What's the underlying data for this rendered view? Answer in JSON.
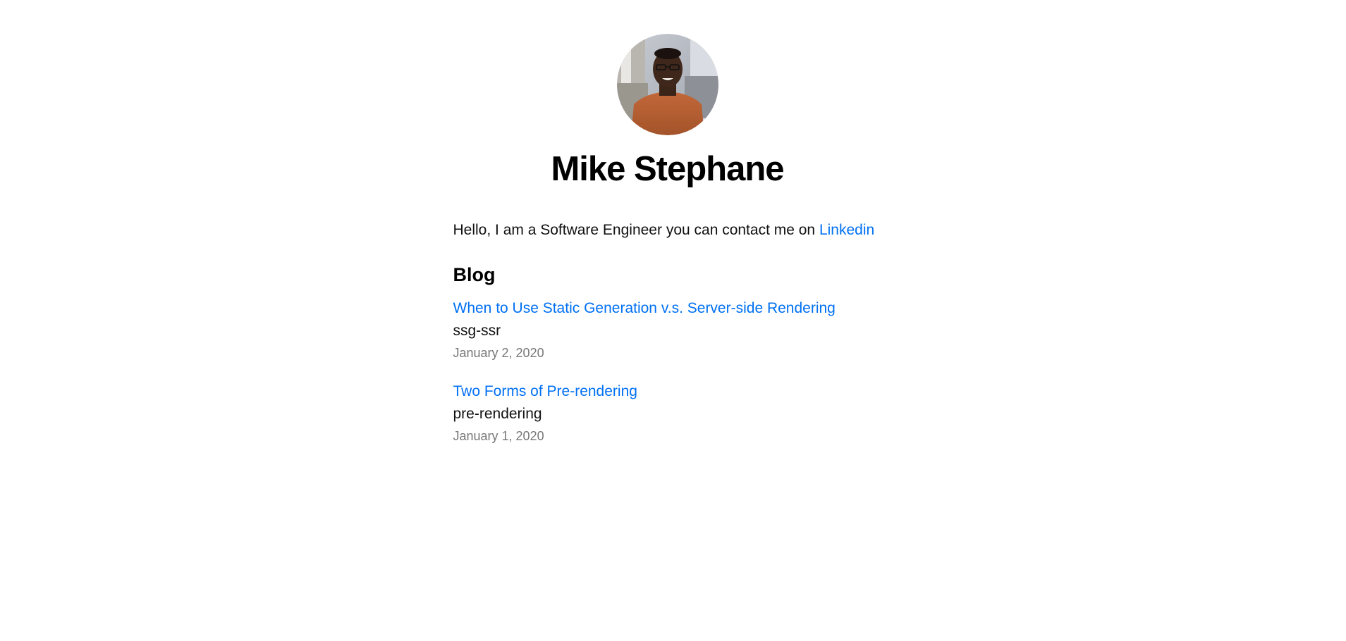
{
  "profile": {
    "name": "Mike Stephane",
    "avatar_alt": "avatar"
  },
  "intro": {
    "text": "Hello, I am a Software Engineer you can contact me on ",
    "link_label": "Linkedin"
  },
  "blog": {
    "heading": "Blog",
    "posts": [
      {
        "title": "When to Use Static Generation v.s. Server-side Rendering",
        "id": "ssg-ssr",
        "date": "January 2, 2020"
      },
      {
        "title": "Two Forms of Pre-rendering",
        "id": "pre-rendering",
        "date": "January 1, 2020"
      }
    ]
  },
  "colors": {
    "link": "#0070f3",
    "date": "#777777",
    "background": "#ffffff"
  }
}
